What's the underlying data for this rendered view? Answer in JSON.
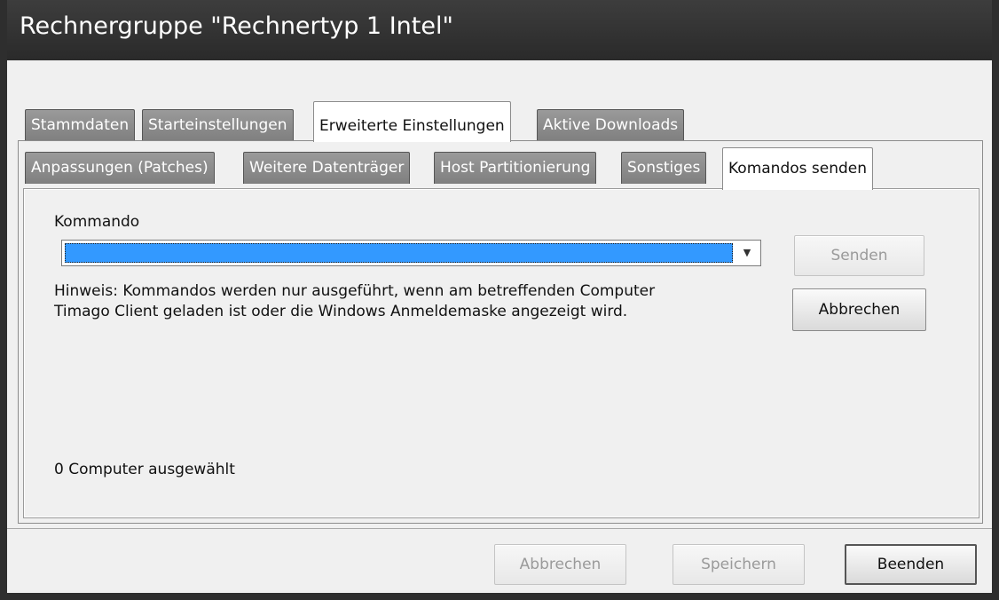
{
  "window": {
    "title": "Rechnergruppe \"Rechnertyp 1 Intel\""
  },
  "outer_tabs": [
    {
      "label": "Stammdaten",
      "active": false
    },
    {
      "label": "Starteinstellungen",
      "active": false
    },
    {
      "label": "Erweiterte Einstellungen",
      "active": true
    },
    {
      "label": "Aktive Downloads",
      "active": false
    }
  ],
  "inner_tabs": [
    {
      "label": "Anpassungen (Patches)",
      "active": false
    },
    {
      "label": "Weitere Datenträger",
      "active": false
    },
    {
      "label": "Host Partitionierung",
      "active": false
    },
    {
      "label": "Sonstiges",
      "active": false
    },
    {
      "label": "Komandos senden",
      "active": true
    }
  ],
  "panel": {
    "command_label": "Kommando",
    "command_value": "",
    "hint_line1": "Hinweis: Kommandos werden nur ausgeführt,  wenn am betreffenden Computer",
    "hint_line2": "Timago Client geladen ist oder die Windows Anmeldemaske angezeigt wird.",
    "send_button": "Senden",
    "cancel_button": "Abbrechen",
    "selection_status": "0 Computer ausgewählt"
  },
  "footer": {
    "cancel_button": "Abbrechen",
    "save_button": "Speichern",
    "close_button": "Beenden"
  },
  "colors": {
    "selection_highlight": "#3399ff",
    "title_bar": "#2e2e2e",
    "inactive_tab": "#8a8a8a"
  }
}
